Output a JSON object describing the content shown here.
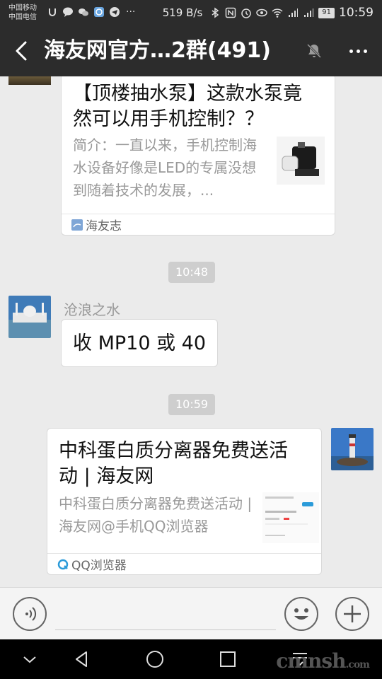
{
  "status_bar": {
    "carrier_1": "中国移动",
    "carrier_2": "中国电信",
    "more_indicator": "···",
    "network_speed": "519 B/s",
    "battery": "91",
    "time": "10:59"
  },
  "header": {
    "title": "海友网官方…2群(491)"
  },
  "messages": {
    "card_1": {
      "title": "【顶楼抽水泵】这款水泵竟然可以用手机控制？？",
      "description": "简介：一直以来，手机控制海水设备好像是LED的专属没想到随着技术的发展，...",
      "source": "海友志"
    },
    "time_1": "10:48",
    "text_1": {
      "sender": "沧浪之水",
      "text": "收 MP10 或 40"
    },
    "time_2": "10:59",
    "card_2": {
      "title": "中科蛋白质分离器免费送活动 | 海友网",
      "description": "中科蛋白质分离器免费送活动 | 海友网@手机QQ浏览器",
      "source": "QQ浏览器"
    }
  },
  "input": {
    "placeholder": ""
  },
  "watermark": {
    "main": "cmnsh",
    "suffix": ".com"
  }
}
